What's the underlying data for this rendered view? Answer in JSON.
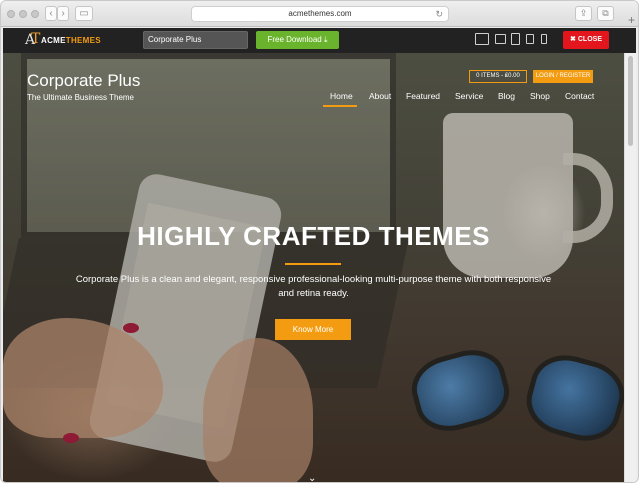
{
  "browser": {
    "url": "acmethemes.com",
    "back_icon": "chevron-left-icon",
    "forward_icon": "chevron-right-icon",
    "sidebar_icon": "sidebar-icon",
    "reload_icon": "reload-icon",
    "share_icon": "share-icon",
    "tabs_icon": "tabs-icon",
    "new_tab_icon": "plus-icon"
  },
  "acmebar": {
    "logo_white": "ACME",
    "logo_orange": "THEMES",
    "theme_select_value": "Corporate Plus",
    "download_label": "Free Download",
    "download_icon": "download-icon",
    "close_label": "CLOSE",
    "close_icon": "close-icon",
    "devices": [
      "desktop-icon",
      "laptop-icon",
      "tablet-icon",
      "tablet-portrait-icon",
      "mobile-icon"
    ],
    "colors": {
      "download": "#6ab42d",
      "close": "#e3161d",
      "bar": "#222222"
    }
  },
  "site": {
    "title": "Corporate Plus",
    "tagline": "The Ultimate Business Theme",
    "cart_label": "0 ITEMS - ₤0.00",
    "login_label": "LOGIN / REGISTER",
    "accent": "#f39c12",
    "nav": [
      "Home",
      "About",
      "Featured",
      "Service",
      "Blog",
      "Shop",
      "Contact"
    ],
    "nav_active": "Home"
  },
  "hero": {
    "title": "HIGHLY CRAFTED THEMES",
    "description": "Corporate Plus is a clean  and elegant, responsive professional-looking multi-purpose theme with both responsive and retina ready.",
    "button_label": "Know More",
    "scroll_icon": "chevron-down-icon"
  }
}
